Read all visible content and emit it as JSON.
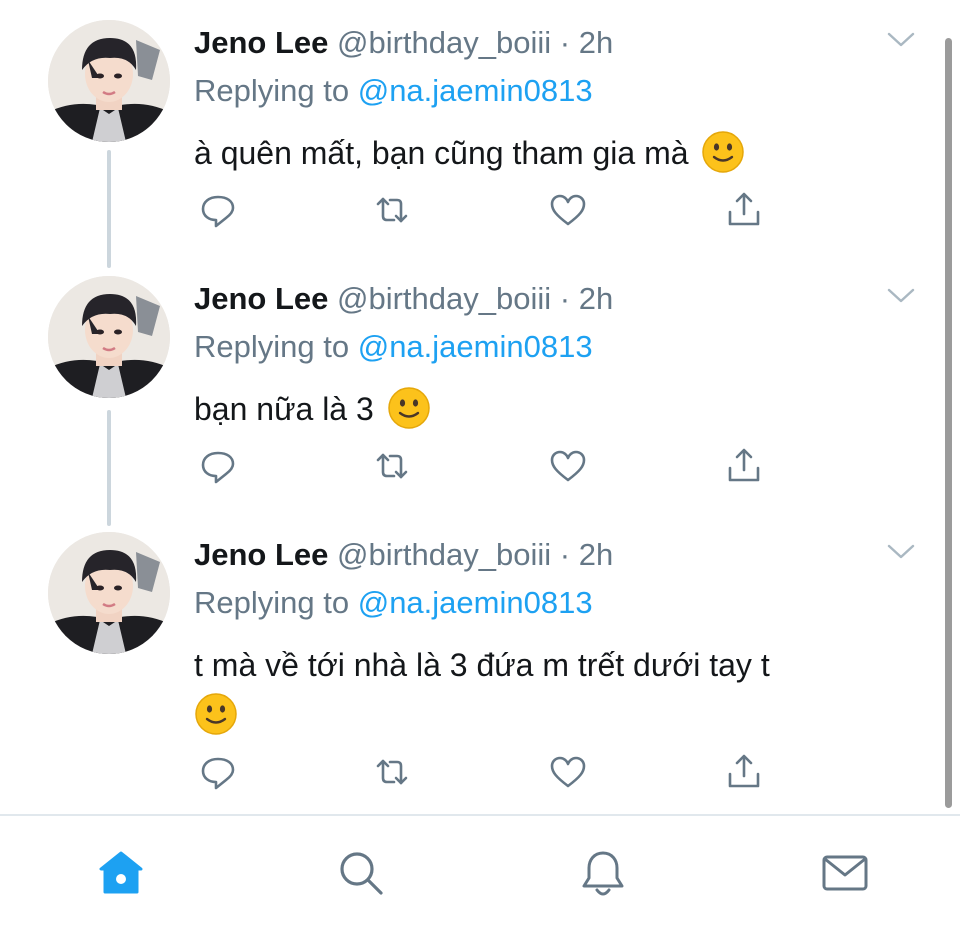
{
  "tweets": [
    {
      "name": "Jeno Lee",
      "handle": "@birthday_boiii",
      "separator": "·",
      "time": "2h",
      "replying_prefix": "Replying to",
      "replying_to": "@na.jaemin0813",
      "text": "à quên mất, bạn cũng tham gia mà",
      "emoji": "slightly-smiling-face"
    },
    {
      "name": "Jeno Lee",
      "handle": "@birthday_boiii",
      "separator": "·",
      "time": "2h",
      "replying_prefix": "Replying to",
      "replying_to": "@na.jaemin0813",
      "text": "bạn nữa là 3",
      "emoji": "slightly-smiling-face"
    },
    {
      "name": "Jeno Lee",
      "handle": "@birthday_boiii",
      "separator": "·",
      "time": "2h",
      "replying_prefix": "Replying to",
      "replying_to": "@na.jaemin0813",
      "text": "t mà về tới nhà là 3 đứa m trết dưới tay t",
      "emoji": "slightly-smiling-face"
    }
  ],
  "tweet_actions": [
    "reply-icon",
    "retweet-icon",
    "like-icon",
    "share-icon"
  ],
  "tabbar": {
    "items": [
      "home-icon",
      "search-icon",
      "notifications-icon",
      "messages-icon"
    ],
    "active": "home-icon"
  },
  "colors": {
    "accent": "#1da1f2",
    "secondary_text": "#657786",
    "primary_text": "#14171a",
    "thread_line": "#ccd6dd",
    "divider": "#e1e8ed"
  }
}
